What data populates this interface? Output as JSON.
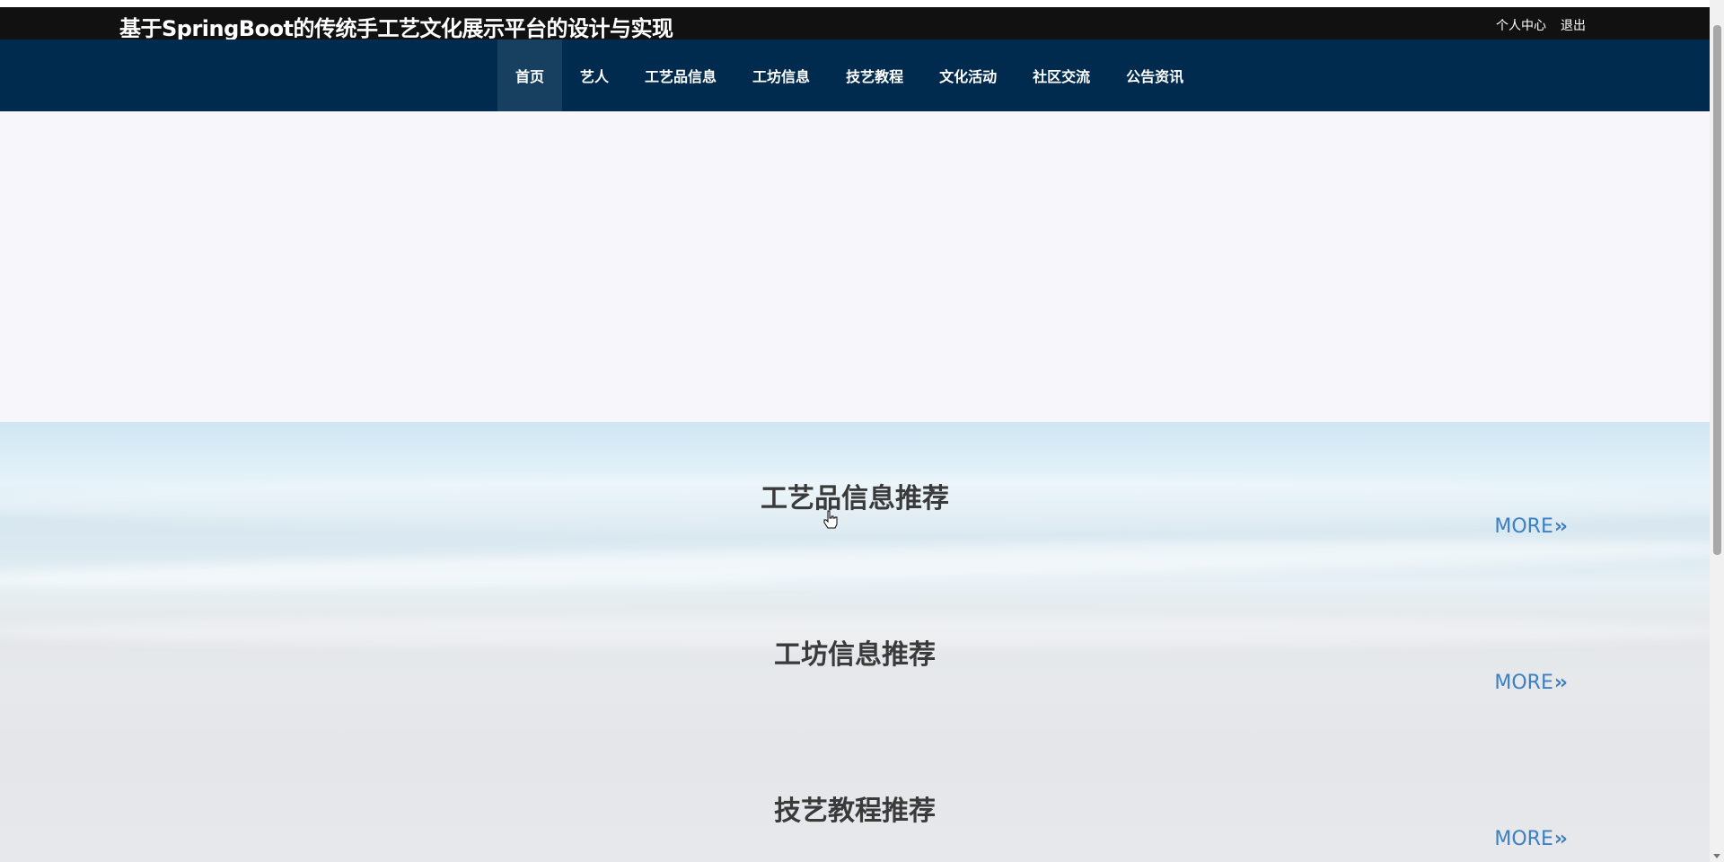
{
  "header": {
    "title": "基于SpringBoot的传统手工艺文化展示平台的设计与实现",
    "links": [
      {
        "label": "个人中心"
      },
      {
        "label": "退出"
      }
    ]
  },
  "nav": {
    "items": [
      {
        "label": "首页",
        "active": true
      },
      {
        "label": "艺人"
      },
      {
        "label": "工艺品信息"
      },
      {
        "label": "工坊信息"
      },
      {
        "label": "技艺教程"
      },
      {
        "label": "文化活动"
      },
      {
        "label": "社区交流"
      },
      {
        "label": "公告资讯"
      }
    ]
  },
  "sections": [
    {
      "title": "工艺品信息推荐",
      "more_label": "MORE"
    },
    {
      "title": "工坊信息推荐",
      "more_label": "MORE"
    },
    {
      "title": "技艺教程推荐",
      "more_label": "MORE"
    }
  ],
  "icons": {
    "more": "double-chevron-right-icon",
    "cursor": "hand-pointer-icon"
  },
  "colors": {
    "topbar": "#111111",
    "navbar": "#002b4e",
    "nav_active": "#173f5f",
    "more_link": "#3b7fc4",
    "section_title": "#3a3a3a"
  }
}
